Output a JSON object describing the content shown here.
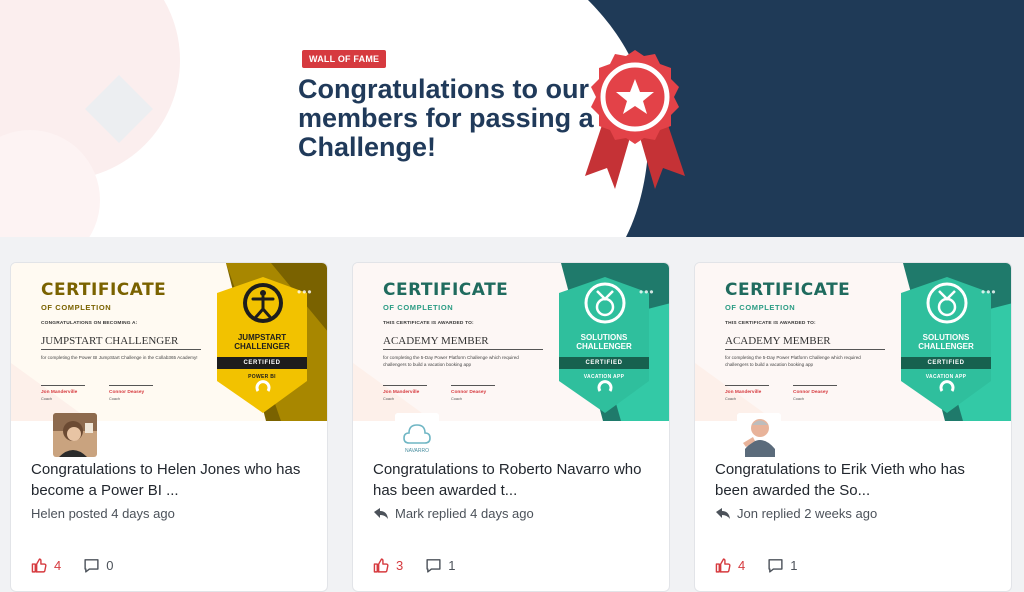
{
  "banner": {
    "badge": "WALL OF FAME",
    "title": "Congratulations to our members for passing a Challenge!"
  },
  "cards": [
    {
      "certificate": {
        "title": "CERTIFICATE",
        "subtitle": "OF COMPLETION",
        "congrats": "CONGRATULATIONS ON BECOMING A:",
        "name": "JUMPSTART CHALLENGER",
        "desc": "for completing the Power BI JumpStart Challenge in the Collab365 Academy!",
        "signer1": "Jon Manderville",
        "signer1_role": "Coach",
        "signer2": "Connor Deasey",
        "signer2_role": "Coach",
        "badge_label": "JUMPSTART CHALLENGER",
        "badge_certified": "CERTIFIED",
        "badge_foot": "POWER BI"
      },
      "post_title": "Congratulations to Helen Jones who has become a Power BI ...",
      "meta": "Helen posted 4 days ago",
      "likes": "4",
      "comments": "0"
    },
    {
      "certificate": {
        "title": "CERTIFICATE",
        "subtitle": "OF COMPLETION",
        "congrats": "THIS CERTIFICATE IS AWARDED TO:",
        "name": "ACADEMY MEMBER",
        "desc": "for completing the 5-Day Power Platform Challenge which required challengers to build a vacation booking app",
        "signer1": "Jon Manderville",
        "signer1_role": "Coach",
        "signer2": "Connor Deasey",
        "signer2_role": "Coach",
        "badge_label": "SOLUTIONS CHALLENGER",
        "badge_certified": "CERTIFIED",
        "badge_foot": "VACATION APP"
      },
      "avatar_text": "NAVARRO",
      "post_title": "Congratulations to Roberto Navarro who has been awarded t...",
      "meta": "Mark replied 4 days ago",
      "likes": "3",
      "comments": "1"
    },
    {
      "certificate": {
        "title": "CERTIFICATE",
        "subtitle": "OF COMPLETION",
        "congrats": "THIS CERTIFICATE IS AWARDED TO:",
        "name": "ACADEMY MEMBER",
        "desc": "for completing the 5-Day Power Platform Challenge which required challengers to build a vacation booking app",
        "signer1": "Jon Manderville",
        "signer1_role": "Coach",
        "signer2": "Connor Deasey",
        "signer2_role": "Coach",
        "badge_label": "SOLUTIONS CHALLENGER",
        "badge_certified": "CERTIFIED",
        "badge_foot": "VACATION APP"
      },
      "post_title": "Congratulations to Erik Vieth who has been awarded the So...",
      "meta": "Jon replied 2 weeks ago",
      "likes": "4",
      "comments": "1"
    }
  ],
  "icons": {
    "award": "award-ribbon-icon",
    "like": "thumbs-up-icon",
    "comment": "comment-icon",
    "reply": "reply-arrow-icon",
    "more": "more-dots-icon"
  },
  "colors": {
    "navy": "#1f3a57",
    "accent_red": "#d63a3f",
    "gold": "#7a6200",
    "yellow": "#f2c200",
    "teal": "#1f7a6b",
    "mint": "#33c9a6"
  }
}
